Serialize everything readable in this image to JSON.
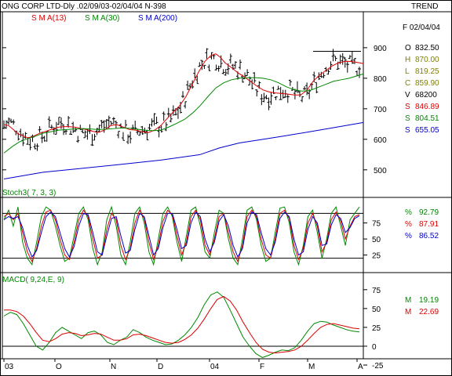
{
  "header": {
    "title": "ONG CORP LTD-Dly .02/09/03-02/04/04  N-398",
    "trend": "TREND"
  },
  "legend": {
    "sma13": "S M A(13)",
    "sma30": "S M A(30)",
    "sma200": "S M A(200)"
  },
  "info": {
    "date": "F 02/04/04",
    "rows": [
      {
        "k": "O",
        "v": "832.50",
        "color": "#000000"
      },
      {
        "k": "H",
        "v": "870.00",
        "color": "#808000"
      },
      {
        "k": "L",
        "v": "819.25",
        "color": "#808000"
      },
      {
        "k": "C",
        "v": "859.90",
        "color": "#808000"
      },
      {
        "k": "V",
        "v": "68200",
        "color": "#000000"
      },
      {
        "k": "S",
        "v": "846.89",
        "color": "#dd0000"
      },
      {
        "k": "S",
        "v": "804.51",
        "color": "#008800"
      },
      {
        "k": "S",
        "v": "655.05",
        "color": "#0000cc"
      }
    ]
  },
  "stoch": {
    "title": "Stoch3( 7, 3, 3)",
    "rows": [
      {
        "k": "%",
        "v": "92.79",
        "color": "#008800"
      },
      {
        "k": "%",
        "v": "87.91",
        "color": "#dd0000"
      },
      {
        "k": "%",
        "v": "86.52",
        "color": "#0000cc"
      }
    ]
  },
  "macd": {
    "title": "MACD( 9,24,E, 9)",
    "rows": [
      {
        "k": "M",
        "v": "19.19",
        "color": "#008800"
      },
      {
        "k": "M",
        "v": "22.69",
        "color": "#dd0000"
      }
    ]
  },
  "colors": {
    "sma13": "#dd0000",
    "sma30": "#008800",
    "sma200": "#0000cc",
    "bars": "#000000",
    "frame": "#000000"
  },
  "chart_data": [
    {
      "type": "ohlc",
      "title": "ONG CORP LTD-Dly .02/09/03-02/04/04  N-398",
      "ylim": [
        420,
        1010
      ],
      "yticks": [
        500,
        600,
        700,
        800,
        900
      ],
      "trendline": {
        "value": 888
      },
      "x_labels": [
        "03",
        "O",
        "N",
        "D",
        "04",
        "F",
        "M",
        "A"
      ],
      "series": [
        {
          "name": "S M A(13)",
          "points": [
            [
              0,
              648
            ],
            [
              6,
              645
            ],
            [
              12,
              632
            ],
            [
              18,
              618
            ],
            [
              24,
              612
            ],
            [
              30,
              605
            ],
            [
              36,
              608
            ],
            [
              44,
              618
            ],
            [
              52,
              625
            ],
            [
              60,
              632
            ],
            [
              70,
              640
            ],
            [
              80,
              642
            ],
            [
              90,
              640
            ],
            [
              100,
              635
            ],
            [
              110,
              628
            ],
            [
              120,
              622
            ],
            [
              128,
              630
            ],
            [
              136,
              645
            ],
            [
              144,
              648
            ],
            [
              152,
              640
            ],
            [
              160,
              632
            ],
            [
              168,
              630
            ],
            [
              176,
              625
            ],
            [
              184,
              622
            ],
            [
              192,
              630
            ],
            [
              200,
              645
            ],
            [
              208,
              668
            ],
            [
              216,
              690
            ],
            [
              224,
              710
            ],
            [
              232,
              740
            ],
            [
              240,
              780
            ],
            [
              248,
              820
            ],
            [
              256,
              855
            ],
            [
              264,
              875
            ],
            [
              270,
              880
            ],
            [
              276,
              868
            ],
            [
              282,
              850
            ],
            [
              290,
              835
            ],
            [
              298,
              818
            ],
            [
              306,
              805
            ],
            [
              314,
              790
            ],
            [
              322,
              775
            ],
            [
              330,
              762
            ],
            [
              338,
              755
            ],
            [
              346,
              752
            ],
            [
              354,
              750
            ],
            [
              362,
              748
            ],
            [
              370,
              745
            ],
            [
              378,
              745
            ],
            [
              386,
              760
            ],
            [
              394,
              790
            ],
            [
              402,
              810
            ],
            [
              410,
              825
            ],
            [
              418,
              840
            ],
            [
              426,
              850
            ],
            [
              434,
              855
            ],
            [
              442,
              855
            ],
            [
              450,
              852
            ],
            [
              458,
              848
            ]
          ]
        },
        {
          "name": "S M A(30)",
          "points": [
            [
              0,
              555
            ],
            [
              10,
              575
            ],
            [
              20,
              592
            ],
            [
              30,
              602
            ],
            [
              40,
              610
            ],
            [
              50,
              620
            ],
            [
              60,
              625
            ],
            [
              70,
              630
            ],
            [
              80,
              632
            ],
            [
              90,
              634
            ],
            [
              100,
              635
            ],
            [
              110,
              634
            ],
            [
              120,
              632
            ],
            [
              130,
              633
            ],
            [
              140,
              635
            ],
            [
              150,
              637
            ],
            [
              160,
              636
            ],
            [
              170,
              633
            ],
            [
              180,
              630
            ],
            [
              190,
              628
            ],
            [
              200,
              630
            ],
            [
              210,
              640
            ],
            [
              220,
              652
            ],
            [
              230,
              665
            ],
            [
              240,
              685
            ],
            [
              250,
              710
            ],
            [
              260,
              740
            ],
            [
              270,
              768
            ],
            [
              280,
              785
            ],
            [
              290,
              795
            ],
            [
              300,
              800
            ],
            [
              310,
              802
            ],
            [
              320,
              802
            ],
            [
              330,
              800
            ],
            [
              340,
              795
            ],
            [
              350,
              785
            ],
            [
              360,
              772
            ],
            [
              370,
              762
            ],
            [
              380,
              758
            ],
            [
              390,
              760
            ],
            [
              400,
              770
            ],
            [
              410,
              780
            ],
            [
              420,
              790
            ],
            [
              430,
              795
            ],
            [
              440,
              800
            ],
            [
              450,
              808
            ],
            [
              458,
              814
            ]
          ]
        },
        {
          "name": "S M A(200)",
          "points": [
            [
              0,
              470
            ],
            [
              50,
              492
            ],
            [
              100,
              505
            ],
            [
              150,
              518
            ],
            [
              200,
              532
            ],
            [
              250,
              550
            ],
            [
              275,
              572
            ],
            [
              300,
              588
            ],
            [
              330,
              600
            ],
            [
              360,
              612
            ],
            [
              390,
              625
            ],
            [
              420,
              638
            ],
            [
              458,
              655
            ]
          ]
        }
      ]
    },
    {
      "type": "line",
      "title": "Stoch3( 7, 3, 3)",
      "ylim": [
        0,
        110
      ],
      "yticks": [
        25,
        50,
        75
      ],
      "reference_lines": [
        20,
        90
      ],
      "series": [
        {
          "name": "%",
          "values": [
            80,
            95,
            70,
            100,
            45,
            20,
            10,
            45,
            85,
            100,
            95,
            70,
            40,
            15,
            20,
            55,
            90,
            100,
            80,
            35,
            10,
            30,
            80,
            100,
            70,
            25,
            10,
            45,
            90,
            100,
            75,
            30,
            10,
            50,
            90,
            100,
            85,
            45,
            15,
            55,
            95,
            100,
            70,
            30,
            20,
            60,
            95,
            90,
            50,
            20,
            10,
            50,
            95,
            100,
            80,
            40,
            15,
            20,
            60,
            98,
            100,
            75,
            30,
            10,
            40,
            85,
            95,
            60,
            20,
            50,
            90,
            100,
            70,
            40,
            80,
            90,
            100
          ]
        },
        {
          "name": "%",
          "values": [
            85,
            90,
            80,
            90,
            60,
            30,
            15,
            35,
            70,
            92,
            95,
            80,
            50,
            25,
            18,
            45,
            80,
            95,
            85,
            50,
            20,
            25,
            65,
            90,
            80,
            40,
            18,
            35,
            75,
            95,
            82,
            45,
            18,
            40,
            78,
            95,
            88,
            55,
            25,
            45,
            85,
            95,
            80,
            40,
            25,
            50,
            85,
            90,
            60,
            30,
            15,
            40,
            85,
            95,
            85,
            50,
            25,
            20,
            50,
            90,
            95,
            82,
            40,
            18,
            35,
            75,
            90,
            70,
            30,
            45,
            80,
            92,
            78,
            50,
            70,
            85,
            88
          ]
        },
        {
          "name": "%",
          "values": [
            80,
            85,
            82,
            85,
            68,
            40,
            22,
            32,
            60,
            85,
            92,
            85,
            60,
            35,
            22,
            38,
            70,
            90,
            88,
            60,
            30,
            25,
            55,
            82,
            85,
            55,
            28,
            32,
            65,
            90,
            85,
            55,
            25,
            35,
            68,
            90,
            90,
            65,
            35,
            40,
            75,
            92,
            85,
            50,
            30,
            45,
            78,
            88,
            70,
            40,
            22,
            35,
            75,
            92,
            88,
            60,
            35,
            25,
            45,
            82,
            92,
            85,
            50,
            25,
            30,
            65,
            85,
            75,
            40,
            42,
            72,
            88,
            82,
            60,
            68,
            82,
            86
          ]
        }
      ]
    },
    {
      "type": "line",
      "title": "MACD( 9,24,E, 9)",
      "ylim": [
        -25,
        80
      ],
      "yticks": [
        -25,
        0,
        25,
        50,
        75
      ],
      "reference_lines": [
        0
      ],
      "series": [
        {
          "name": "M",
          "values": [
            40,
            45,
            42,
            30,
            15,
            0,
            -5,
            5,
            18,
            25,
            20,
            15,
            10,
            18,
            20,
            15,
            5,
            2,
            8,
            12,
            22,
            18,
            12,
            8,
            5,
            2,
            3,
            8,
            15,
            25,
            38,
            55,
            68,
            72,
            65,
            48,
            30,
            12,
            0,
            -10,
            -15,
            -12,
            -8,
            -5,
            -6,
            -2,
            8,
            20,
            30,
            33,
            32,
            28,
            25,
            22,
            20,
            19
          ]
        },
        {
          "name": "M",
          "values": [
            48,
            48,
            46,
            40,
            30,
            18,
            8,
            6,
            10,
            16,
            18,
            17,
            14,
            15,
            17,
            16,
            12,
            8,
            8,
            10,
            15,
            16,
            14,
            11,
            8,
            5,
            4,
            5,
            9,
            15,
            24,
            36,
            50,
            62,
            66,
            60,
            48,
            32,
            18,
            5,
            -4,
            -8,
            -9,
            -8,
            -7,
            -5,
            0,
            8,
            17,
            25,
            29,
            30,
            28,
            26,
            24,
            23
          ]
        }
      ]
    }
  ]
}
